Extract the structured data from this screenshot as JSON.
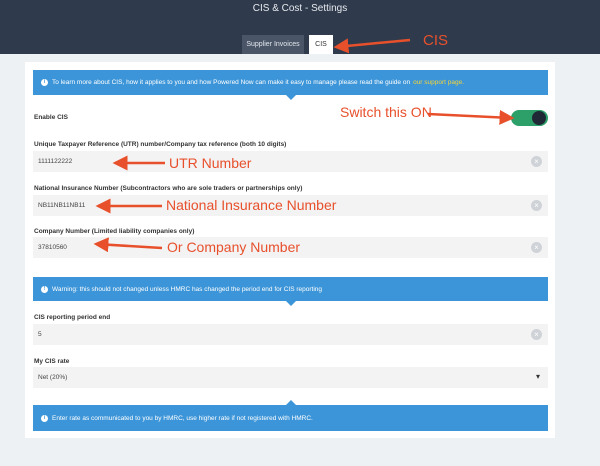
{
  "header": {
    "title": "CIS & Cost - Settings"
  },
  "tabs": [
    {
      "label": "Supplier Invoices"
    },
    {
      "label": "CIS"
    }
  ],
  "info_top": {
    "text": "To learn more about CIS, how it applies to you and how Powered Now can make it easy to manage please read the guide on",
    "link": "our support page."
  },
  "enable_cis": {
    "label": "Enable CIS",
    "on": true
  },
  "utr": {
    "label": "Unique Taxpayer Reference (UTR) number/Company tax reference (both 10 digits)",
    "value": "1111122222"
  },
  "ni": {
    "label": "National Insurance Number (Subcontractors who are sole traders or partnerships only)",
    "value": "NB11NB11NB11"
  },
  "company": {
    "label": "Company Number (Limited liability companies only)",
    "value": "37810560"
  },
  "warning": {
    "text": "Warning: this should not changed unless HMRC has changed the period end for CIS reporting"
  },
  "period_end": {
    "label": "CIS reporting period end",
    "value": "5"
  },
  "rate": {
    "label": "My CIS rate",
    "value": "Net (20%)"
  },
  "info_bottom": {
    "text": "Enter rate as communicated to you by HMRC, use higher rate if not registered with HMRC."
  },
  "annotations": {
    "cis": "CIS",
    "switch": "Switch this ON",
    "utr": "UTR Number",
    "ni": "National Insurance Number",
    "company": "Or Company Number"
  },
  "colors": {
    "header": "#2f3b4c",
    "info": "#3c95d8",
    "toggle_on": "#2d9f68",
    "annotation": "#e8502c",
    "link": "#f1d33b"
  }
}
